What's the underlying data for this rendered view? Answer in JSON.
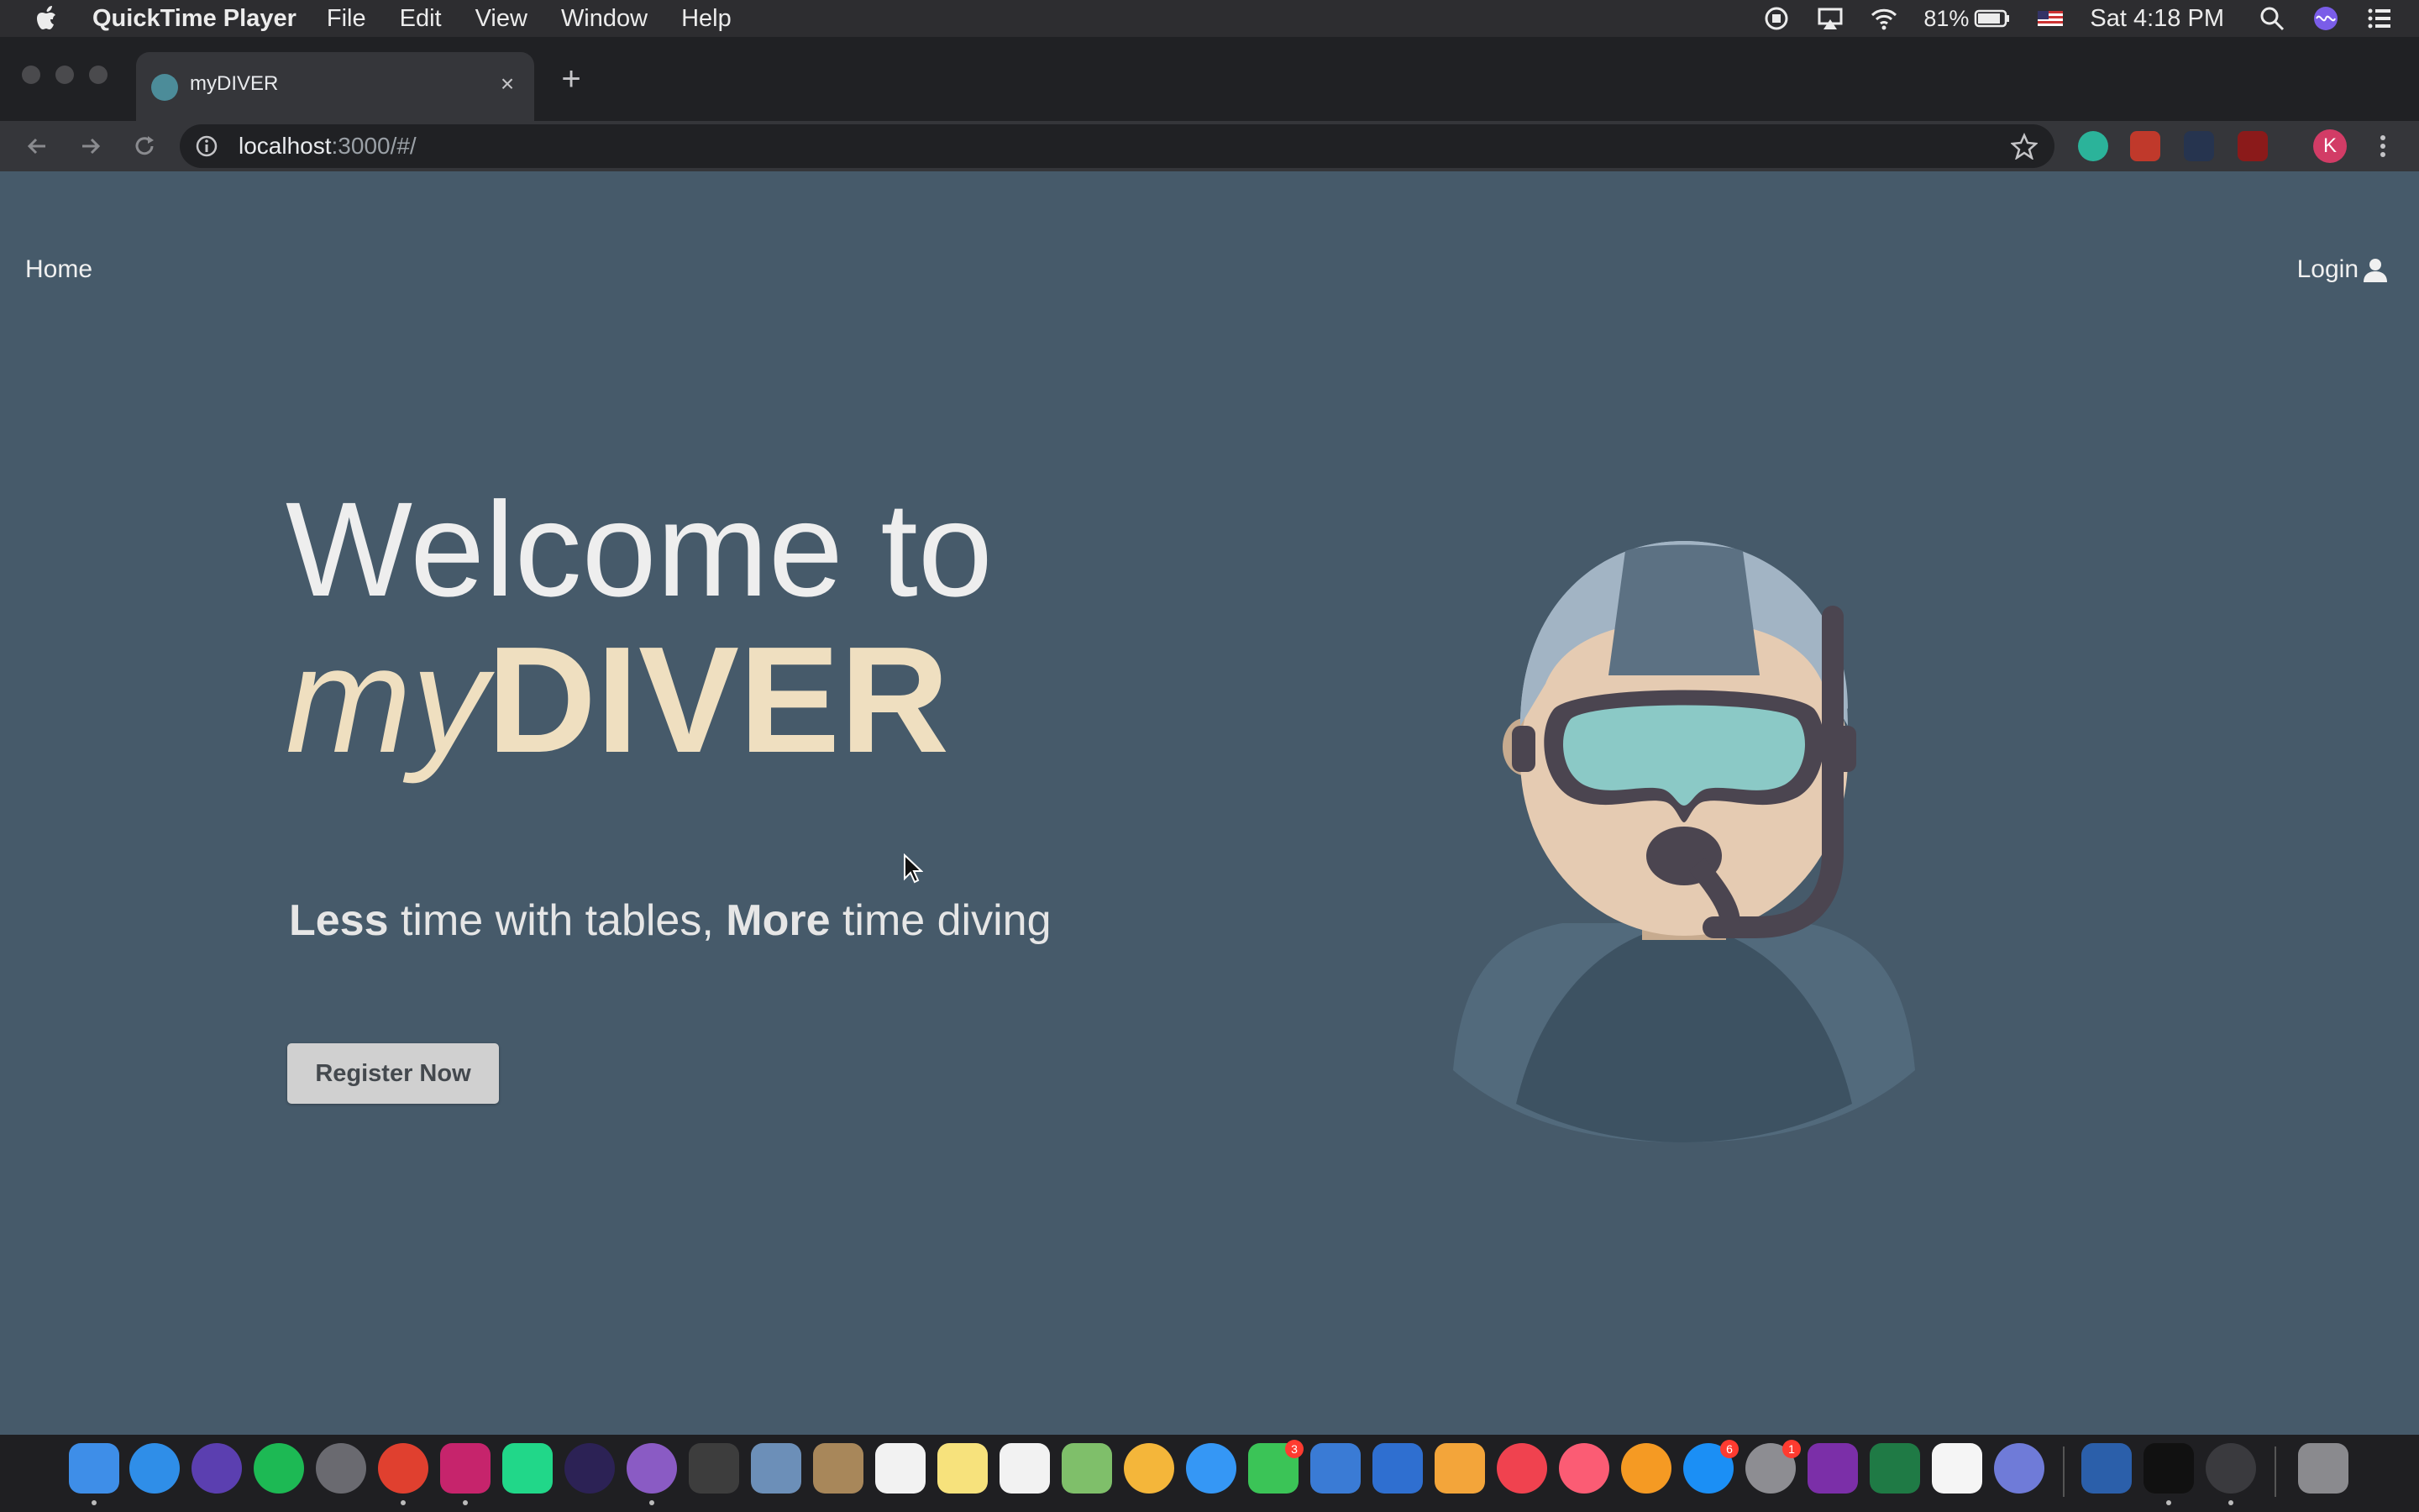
{
  "menubar": {
    "app_name": "QuickTime Player",
    "menus": [
      "File",
      "Edit",
      "View",
      "Window",
      "Help"
    ],
    "battery": "81%",
    "clock": "Sat 4:18 PM"
  },
  "browser": {
    "tab_title": "myDIVER",
    "tab_close": "×",
    "new_tab": "+",
    "url_host": "localhost",
    "url_path": ":3000/#/",
    "profile_initial": "K"
  },
  "page": {
    "nav": {
      "home": "Home",
      "login": "Login"
    },
    "hero": {
      "welcome": "Welcome to",
      "brand_my": "my",
      "brand_diver": "DIVER",
      "tagline_less": "Less",
      "tagline_mid": " time with tables, ",
      "tagline_more": "More",
      "tagline_end": " time diving"
    },
    "register_label": "Register Now"
  },
  "dock": {
    "badges": {
      "facetime": "3",
      "appstore": "6",
      "settings": "1"
    }
  },
  "colors": {
    "page_bg": "#465a6a",
    "brand": "#efdfc0",
    "button_bg": "#d0d0d0"
  }
}
